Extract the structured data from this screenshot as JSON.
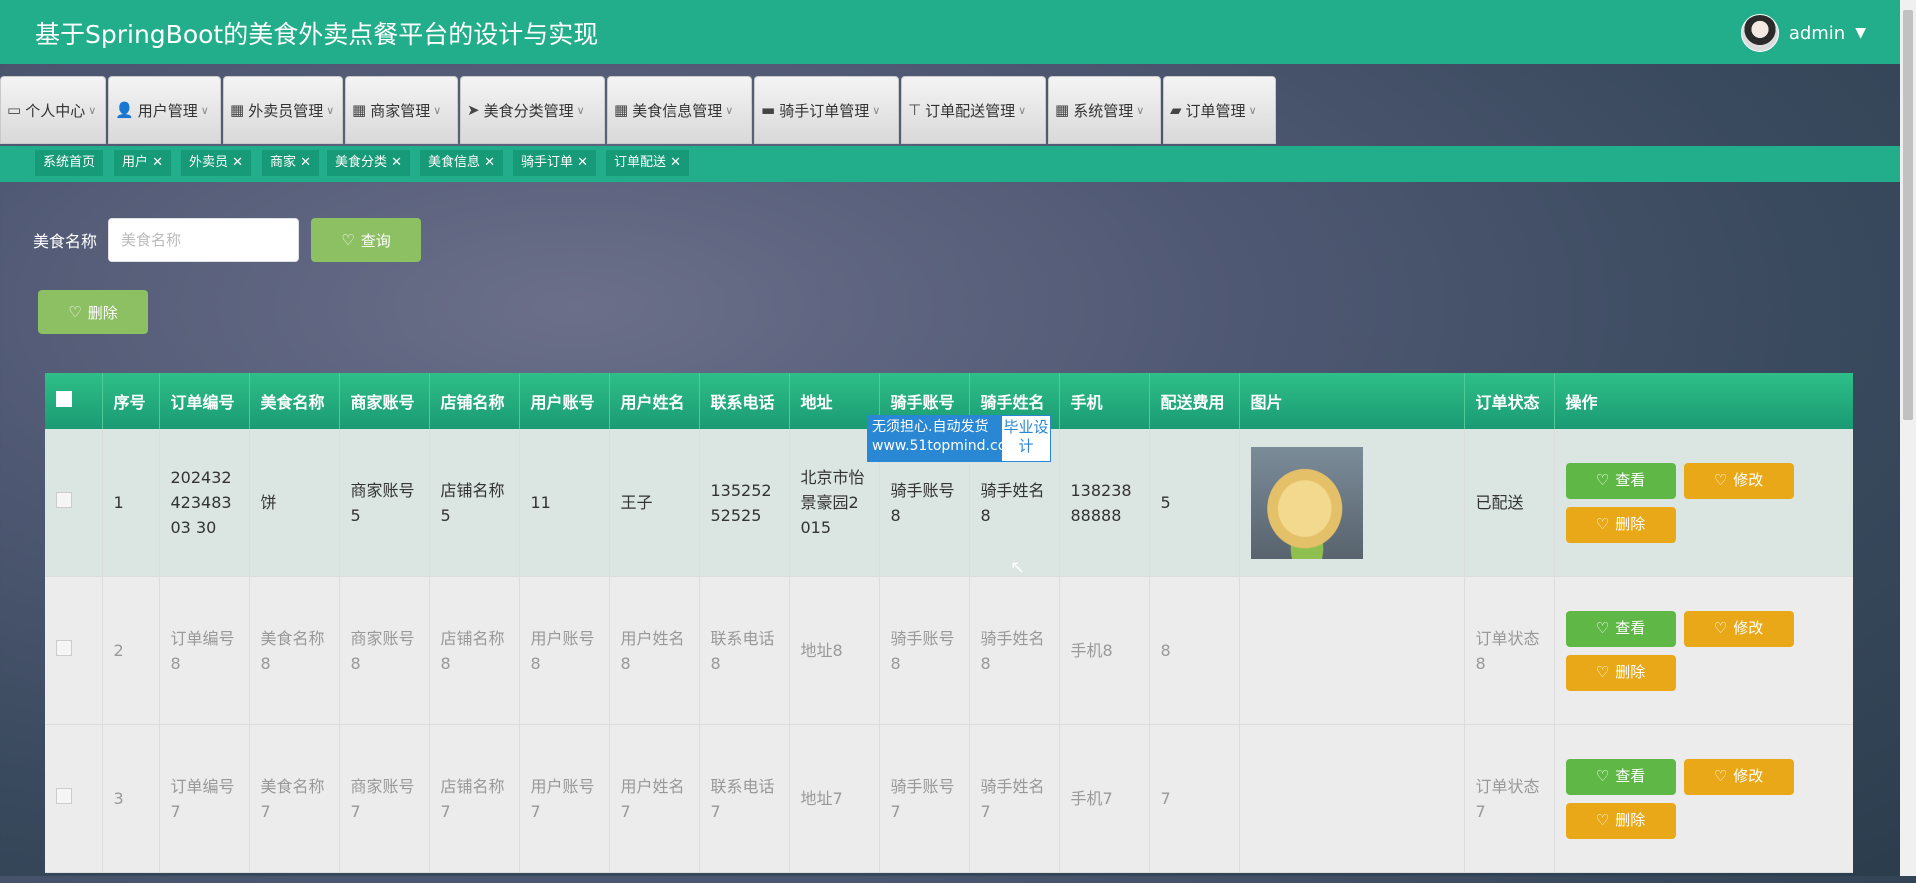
{
  "header": {
    "title": "基于SpringBoot的美食外卖点餐平台的设计与实现",
    "username": "admin"
  },
  "menu": [
    {
      "label": "个人中心",
      "icon": "profile-icon"
    },
    {
      "label": "用户管理",
      "icon": "user-icon"
    },
    {
      "label": "外卖员管理",
      "icon": "grid-icon"
    },
    {
      "label": "商家管理",
      "icon": "grid-icon"
    },
    {
      "label": "美食分类管理",
      "icon": "send-icon"
    },
    {
      "label": "美食信息管理",
      "icon": "grid-icon"
    },
    {
      "label": "骑手订单管理",
      "icon": "monitor-icon"
    },
    {
      "label": "订单配送管理",
      "icon": "pin-icon"
    },
    {
      "label": "系统管理",
      "icon": "grid-icon"
    },
    {
      "label": "订单管理",
      "icon": "ticket-icon"
    }
  ],
  "tags": [
    "系统首页",
    "用户 ✕",
    "外卖员 ✕",
    "商家 ✕",
    "美食分类 ✕",
    "美食信息 ✕",
    "骑手订单 ✕",
    "订单配送 ✕"
  ],
  "search": {
    "label": "美食名称",
    "placeholder": "美食名称",
    "query_button": "查询",
    "delete_button": "删除"
  },
  "table": {
    "columns": [
      "序号",
      "订单编号",
      "美食名称",
      "商家账号",
      "店铺名称",
      "用户账号",
      "用户姓名",
      "联系电话",
      "地址",
      "骑手账号",
      "骑手姓名",
      "手机",
      "配送费用",
      "图片",
      "订单状态",
      "操作"
    ],
    "rows": [
      {
        "no": "1",
        "order": "20243242348303 30",
        "food": "饼",
        "merchant": "商家账号5",
        "shop": "店铺名称5",
        "user": "11",
        "username": "王子",
        "phone": "13525252525",
        "address": "北京市怡景豪园2015",
        "rider": "骑手账号8",
        "ridername": "骑手姓名8",
        "mobile": "13823888888",
        "fee": "5",
        "status": "已配送"
      },
      {
        "no": "2",
        "order": "订单编号8",
        "food": "美食名称8",
        "merchant": "商家账号8",
        "shop": "店铺名称8",
        "user": "用户账号8",
        "username": "用户姓名8",
        "phone": "联系电话8",
        "address": "地址8",
        "rider": "骑手账号8",
        "ridername": "骑手姓名8",
        "mobile": "手机8",
        "fee": "8",
        "status": "订单状态8"
      },
      {
        "no": "3",
        "order": "订单编号7",
        "food": "美食名称7",
        "merchant": "商家账号7",
        "shop": "店铺名称7",
        "user": "用户账号7",
        "username": "用户姓名7",
        "phone": "联系电话7",
        "address": "地址7",
        "rider": "骑手账号7",
        "ridername": "骑手姓名7",
        "mobile": "手机7",
        "fee": "7",
        "status": "订单状态7"
      }
    ],
    "actions": {
      "view": "查看",
      "edit": "修改",
      "delete": "删除"
    }
  },
  "watermark": {
    "line1": "无须担心.自动发货",
    "line2": "www.51topmind.com",
    "right": "毕业设计"
  }
}
